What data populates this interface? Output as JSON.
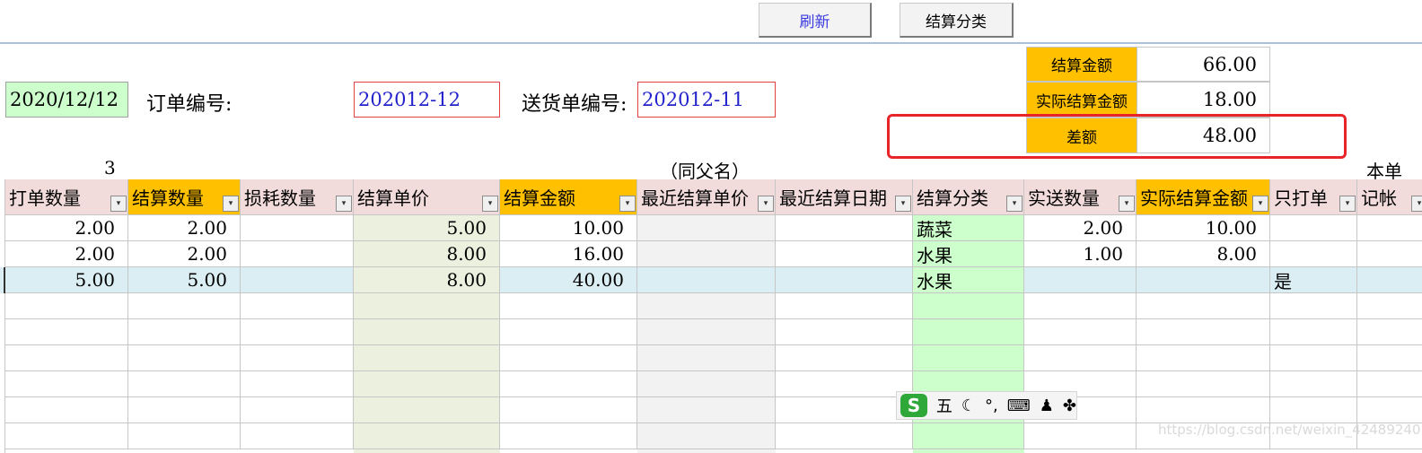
{
  "toolbar": {
    "refresh_label": "刷新",
    "classify_label": "结算分类"
  },
  "colors": {
    "orange": "#ffc000",
    "pink_header": "#f2dcdb",
    "light_green": "#ebf1de",
    "mint": "#ccffcc",
    "selected_row": "#daeef3",
    "date_bg": "#ccffcc",
    "highlight_box": "#e8232a"
  },
  "form": {
    "date_value": "2020/12/12",
    "order_no_label": "订单编号:",
    "order_no_value": "202012-12",
    "delivery_no_label": "送货单编号:",
    "delivery_no_value": "202012-11",
    "count_label": "3",
    "parent_name_label": "（同父名）",
    "this_order_label": "本单"
  },
  "summary": [
    {
      "label": "结算金额",
      "value": "66.00"
    },
    {
      "label": "实际结算金额",
      "value": "18.00"
    },
    {
      "label": "差额",
      "value": "48.00"
    }
  ],
  "table": {
    "columns": [
      "打单数量",
      "结算数量",
      "损耗数量",
      "结算单价",
      "结算金额",
      "最近结算单价",
      "最近结算日期",
      "结算分类",
      "实送数量",
      "实际结算金额",
      "只打单",
      "记帐"
    ],
    "rows": [
      [
        "2.00",
        "2.00",
        "",
        "5.00",
        "10.00",
        "",
        "",
        "蔬菜",
        "2.00",
        "10.00",
        "",
        ""
      ],
      [
        "2.00",
        "2.00",
        "",
        "8.00",
        "16.00",
        "",
        "",
        "水果",
        "1.00",
        "8.00",
        "",
        ""
      ],
      [
        "5.00",
        "5.00",
        "",
        "8.00",
        "40.00",
        "",
        "",
        "水果",
        "",
        "",
        "是",
        ""
      ]
    ]
  },
  "ime_bar": {
    "mode": "五",
    "icons": [
      "moon-icon",
      "punctuation-icon",
      "keyboard-icon",
      "user-icon",
      "grid-icon"
    ]
  },
  "watermark": "https://blog.csdn.net/weixin_42489240"
}
